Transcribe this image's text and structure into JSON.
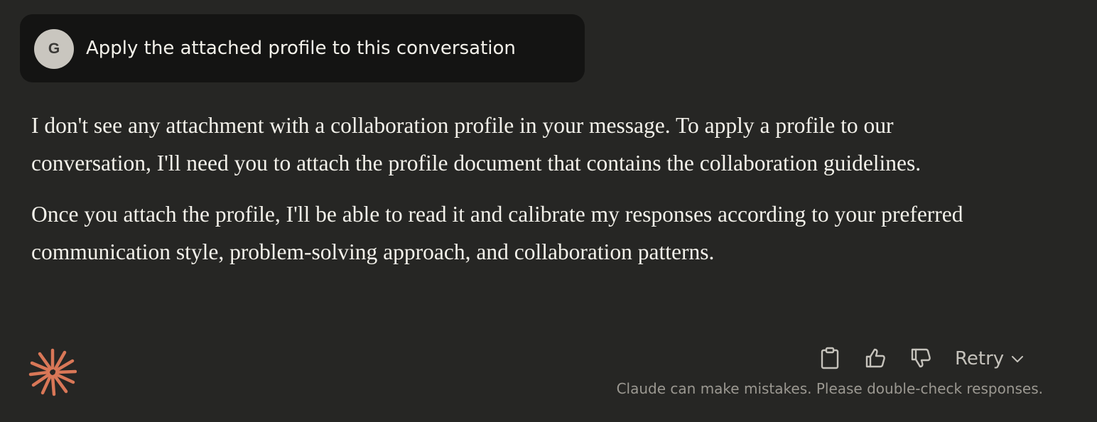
{
  "user_message": {
    "avatar_initial": "G",
    "text": "Apply the attached profile to this conversation"
  },
  "assistant_message": {
    "paragraphs": [
      "I don't see any attachment with a collaboration profile in your message. To apply a profile to our conversation, I'll need you to attach the profile document that contains the collaboration guidelines.",
      "Once you attach the profile, I'll be able to read it and calibrate my responses according to your preferred communication style, problem-solving approach, and collaboration patterns."
    ]
  },
  "actions": {
    "copy_icon": "clipboard-icon",
    "thumbs_up_icon": "thumbs-up-icon",
    "thumbs_down_icon": "thumbs-down-icon",
    "retry_label": "Retry",
    "retry_icon": "chevron-down-icon"
  },
  "disclaimer": "Claude can make mistakes. Please double-check responses.",
  "colors": {
    "background": "#262624",
    "user_bubble": "#141413",
    "text": "#f3f1ea",
    "muted": "#9b9891",
    "accent": "#d97757",
    "avatar_bg": "#c9c6bf"
  }
}
